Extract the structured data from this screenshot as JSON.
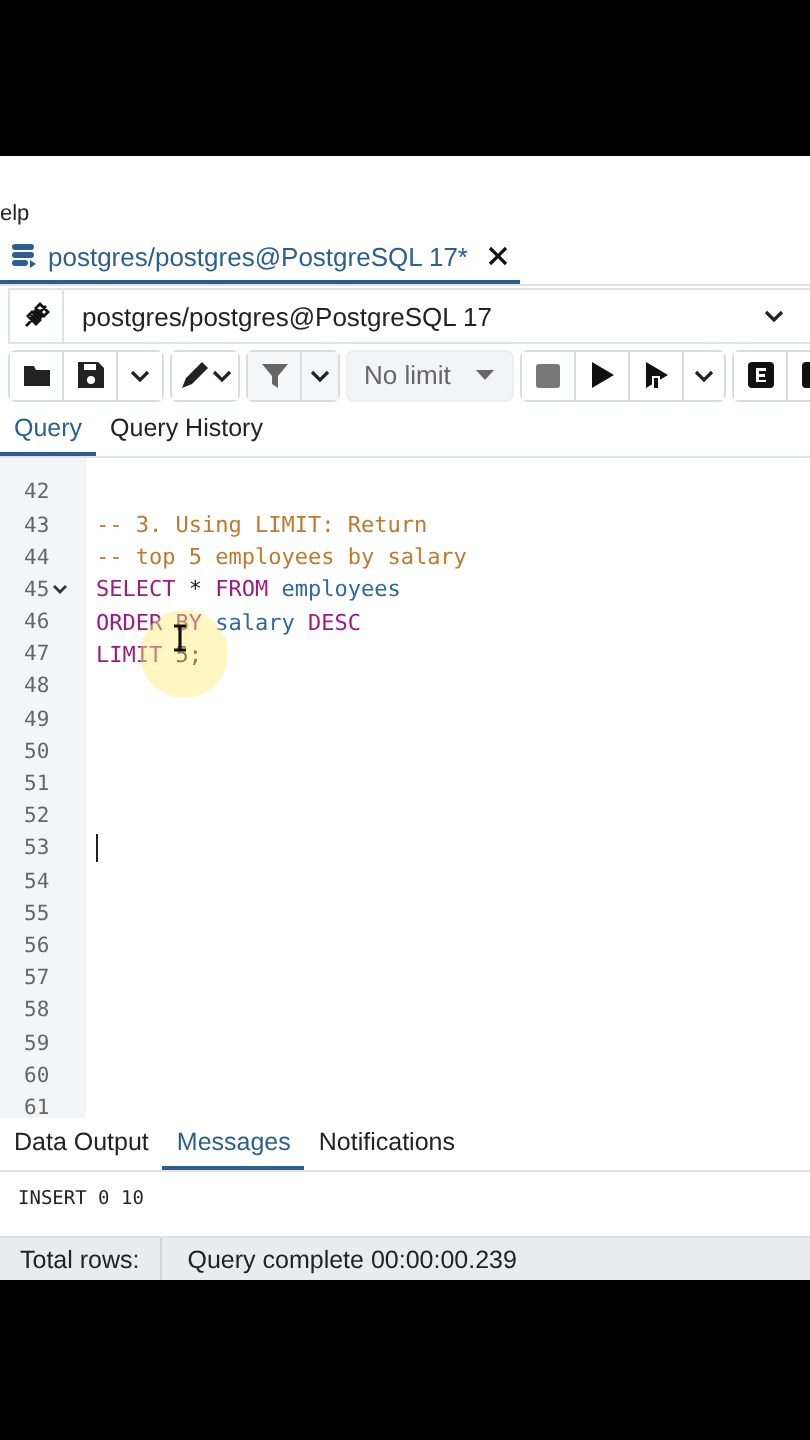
{
  "menu": {
    "partial_item": "elp"
  },
  "query_tab": {
    "title": "postgres/postgres@PostgreSQL 17*",
    "selected": true
  },
  "connection": {
    "value": "postgres/postgres@PostgreSQL 17"
  },
  "toolbar": {
    "row_limit": "No limit"
  },
  "editor_tabs": [
    {
      "label": "Query",
      "selected": true
    },
    {
      "label": "Query History",
      "selected": false
    }
  ],
  "editor": {
    "lines": [
      {
        "number": "42",
        "foldable": false,
        "cursor": false
      },
      {
        "number": "43",
        "foldable": false,
        "cursor": false,
        "tokens": [
          {
            "kind": "comment",
            "text": "-- 3. Using LIMIT: Return"
          }
        ]
      },
      {
        "number": "44",
        "foldable": false,
        "cursor": false,
        "tokens": [
          {
            "kind": "comment",
            "text": "-- top 5 employees by salary"
          }
        ]
      },
      {
        "number": "45",
        "foldable": true,
        "cursor": false,
        "tokens": [
          {
            "kind": "keyword",
            "text": "SELECT"
          },
          {
            "kind": "plain",
            "text": " * "
          },
          {
            "kind": "keyword",
            "text": "FROM"
          },
          {
            "kind": "identifier",
            "text": " employees"
          }
        ]
      },
      {
        "number": "46",
        "foldable": false,
        "cursor": false,
        "tokens": [
          {
            "kind": "keyword",
            "text": "ORDER BY"
          },
          {
            "kind": "identifier",
            "text": " salary"
          },
          {
            "kind": "keyword",
            "text": " DESC"
          }
        ]
      },
      {
        "number": "47",
        "foldable": false,
        "cursor": false,
        "tokens": [
          {
            "kind": "keyword",
            "text": "LIMIT"
          },
          {
            "kind": "plain",
            "text": " 5;"
          }
        ]
      },
      {
        "number": "48",
        "foldable": false,
        "cursor": false
      },
      {
        "number": "49",
        "foldable": false,
        "cursor": false
      },
      {
        "number": "50",
        "foldable": false,
        "cursor": false
      },
      {
        "number": "51",
        "foldable": false,
        "cursor": false
      },
      {
        "number": "52",
        "foldable": false,
        "cursor": false
      },
      {
        "number": "53",
        "foldable": false,
        "cursor": true
      },
      {
        "number": "54",
        "foldable": false,
        "cursor": false
      },
      {
        "number": "55",
        "foldable": false,
        "cursor": false
      },
      {
        "number": "56",
        "foldable": false,
        "cursor": false
      },
      {
        "number": "57",
        "foldable": false,
        "cursor": false
      },
      {
        "number": "58",
        "foldable": false,
        "cursor": false
      },
      {
        "number": "59",
        "foldable": false,
        "cursor": false
      },
      {
        "number": "60",
        "foldable": false,
        "cursor": false
      },
      {
        "number": "61",
        "foldable": false,
        "cursor": false
      }
    ]
  },
  "output_tabs": [
    {
      "label": "Data Output",
      "selected": false
    },
    {
      "label": "Messages",
      "selected": true
    },
    {
      "label": "Notifications",
      "selected": false
    }
  ],
  "messages": [
    "INSERT 0 10"
  ],
  "status_bar": {
    "total_rows_label": "Total rows:",
    "query_status": "Query complete 00:00:00.239"
  }
}
